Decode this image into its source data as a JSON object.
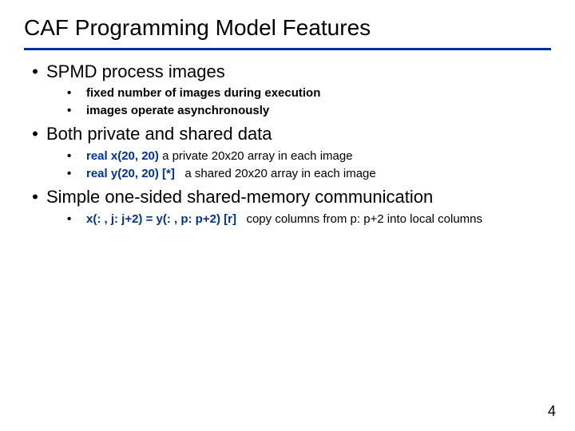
{
  "title": "CAF Programming Model Features",
  "page_number": "4",
  "bullets": [
    {
      "text": "SPMD process images",
      "sub": [
        {
          "plain": "fixed number of images during execution"
        },
        {
          "plain": "images operate asynchronously"
        }
      ]
    },
    {
      "text": "Both private and shared data",
      "sub": [
        {
          "code": "real x(20, 20)",
          "desc": "a private 20x20 array in each image"
        },
        {
          "code": "real y(20, 20) [*]",
          "desc": "a shared 20x20 array in each image"
        }
      ]
    },
    {
      "text": "Simple one-sided shared-memory communication",
      "sub": [
        {
          "code": "x(: , j: j+2) = y(: , p: p+2) [r]",
          "desc": "copy columns from p: p+2 into local columns"
        }
      ]
    }
  ]
}
